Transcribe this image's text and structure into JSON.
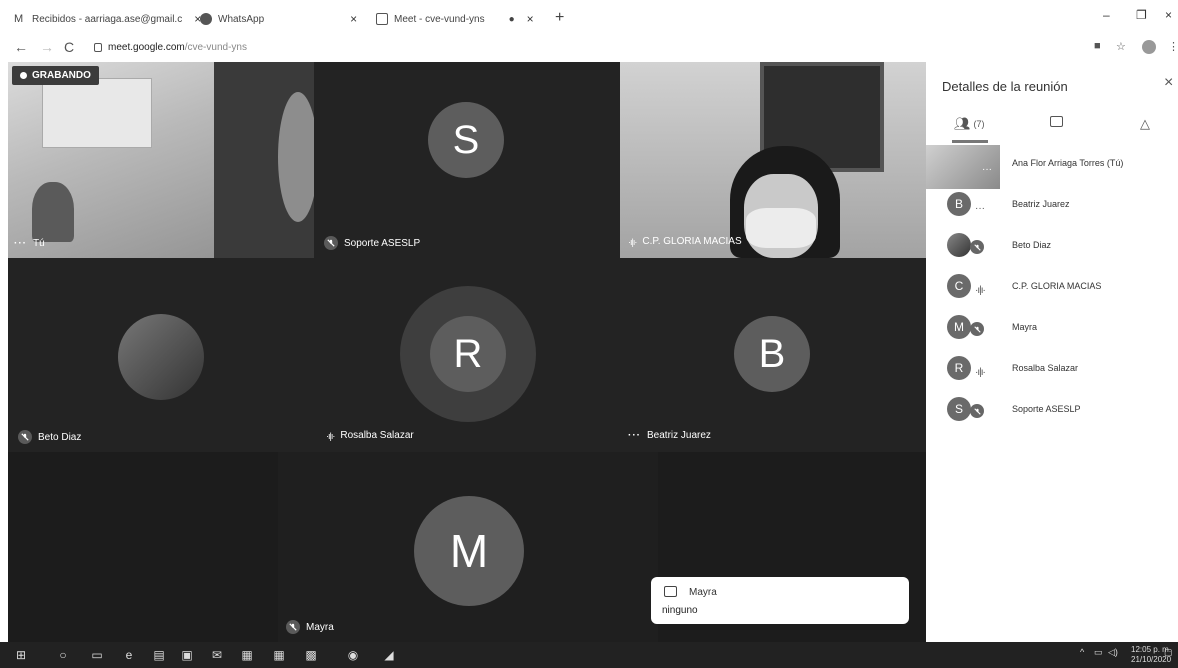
{
  "browser": {
    "tabs": [
      {
        "label": "Recibidos - aarriaga.ase@gmail.c",
        "icon": "gmail-icon"
      },
      {
        "label": "WhatsApp",
        "icon": "whatsapp-icon"
      },
      {
        "label": "Meet - cve-vund-yns",
        "icon": "meet-icon"
      }
    ],
    "url_domain": "meet.google.com",
    "url_path": "/cve-vund-yns"
  },
  "meet": {
    "recording_label": "GRABANDO",
    "tiles": {
      "you": {
        "name": "Tú"
      },
      "soporte": {
        "name": "Soporte ASESLP",
        "initial": "S"
      },
      "gloria": {
        "name": "C.P. GLORIA MACIAS"
      },
      "beto": {
        "name": "Beto Diaz"
      },
      "rosalba": {
        "name": "Rosalba Salazar",
        "initial": "R"
      },
      "beatriz": {
        "name": "Beatriz Juarez",
        "initial": "B"
      },
      "mayra": {
        "name": "Mayra",
        "initial": "M"
      }
    },
    "chat_toast": {
      "sender": "Mayra",
      "message": "ninguno"
    }
  },
  "panel": {
    "title": "Detalles de la reunión",
    "people_count": "(7)",
    "participants": [
      {
        "name": "Ana Flor Arriaga Torres (Tú)",
        "initial": "",
        "status": "dots",
        "photo": true
      },
      {
        "name": "Beatriz Juarez",
        "initial": "B",
        "status": "dots"
      },
      {
        "name": "Beto Diaz",
        "initial": "",
        "status": "muted",
        "photo_small": true
      },
      {
        "name": "C.P. GLORIA MACIAS",
        "initial": "C",
        "status": "speaking"
      },
      {
        "name": "Mayra",
        "initial": "M",
        "status": "muted"
      },
      {
        "name": "Rosalba Salazar",
        "initial": "R",
        "status": "speaking"
      },
      {
        "name": "Soporte ASESLP",
        "initial": "S",
        "status": "muted"
      }
    ]
  },
  "taskbar": {
    "time": "12:05 p. m.",
    "date": "21/10/2020"
  }
}
